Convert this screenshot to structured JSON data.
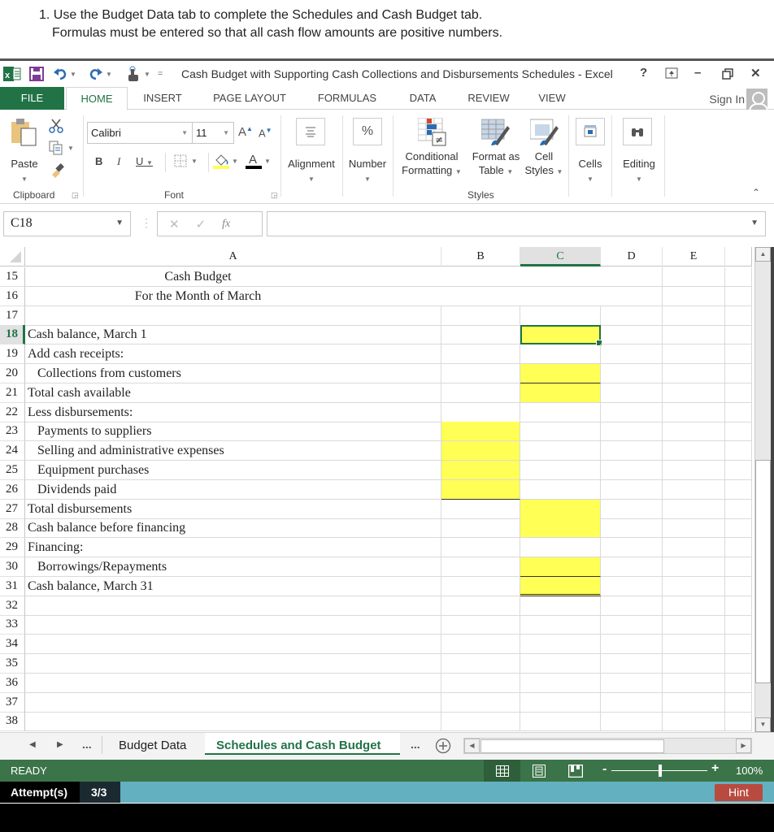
{
  "instructions": {
    "line1": "1. Use the Budget Data tab to complete the Schedules and Cash Budget tab.",
    "line2": "Formulas must be entered so that all cash flow amounts are positive numbers."
  },
  "window": {
    "title": "Cash Budget with Supporting Cash Collections and Disbursements Schedules - Excel",
    "help": "?",
    "minimize": "–",
    "restore": "🗗",
    "close": "✕"
  },
  "ribbon_tabs": [
    "FILE",
    "HOME",
    "INSERT",
    "PAGE LAYOUT",
    "FORMULAS",
    "DATA",
    "REVIEW",
    "VIEW"
  ],
  "sign_in": "Sign In",
  "ribbon": {
    "clipboard": {
      "paste": "Paste",
      "group": "Clipboard"
    },
    "font": {
      "name": "Calibri",
      "size": "11",
      "bold": "B",
      "italic": "I",
      "underline": "U",
      "group": "Font"
    },
    "alignment": "Alignment",
    "number": "Number",
    "number_icon": "%",
    "styles": {
      "conditional_1": "Conditional",
      "conditional_2": "Formatting",
      "format_table_1": "Format as",
      "format_table_2": "Table",
      "cell_styles_1": "Cell",
      "cell_styles_2": "Styles",
      "group": "Styles"
    },
    "cells": "Cells",
    "editing": "Editing"
  },
  "formula_bar": {
    "name_box": "C18",
    "formula": "",
    "fx": "fx"
  },
  "columns": [
    "A",
    "B",
    "C",
    "D",
    "E"
  ],
  "selected_column": "C",
  "rows": [
    {
      "n": "15",
      "a": "Cash Budget",
      "center": true
    },
    {
      "n": "16",
      "a": "For the Month of March",
      "center": true
    },
    {
      "n": "17",
      "a": ""
    },
    {
      "n": "18",
      "a": "Cash balance, March 1"
    },
    {
      "n": "19",
      "a": "Add cash receipts:"
    },
    {
      "n": "20",
      "a": "Collections from customers",
      "indent": true
    },
    {
      "n": "21",
      "a": "Total cash available"
    },
    {
      "n": "22",
      "a": "Less disbursements:"
    },
    {
      "n": "23",
      "a": "Payments to suppliers",
      "indent": true
    },
    {
      "n": "24",
      "a": "Selling and administrative expenses",
      "indent": true
    },
    {
      "n": "25",
      "a": "Equipment purchases",
      "indent": true
    },
    {
      "n": "26",
      "a": "Dividends paid",
      "indent": true
    },
    {
      "n": "27",
      "a": "Total disbursements"
    },
    {
      "n": "28",
      "a": "Cash balance before financing"
    },
    {
      "n": "29",
      "a": "Financing:"
    },
    {
      "n": "30",
      "a": "Borrowings/Repayments",
      "indent": true
    },
    {
      "n": "31",
      "a": "Cash balance, March 31"
    },
    {
      "n": "32",
      "a": ""
    },
    {
      "n": "33",
      "a": ""
    },
    {
      "n": "34",
      "a": ""
    },
    {
      "n": "35",
      "a": ""
    },
    {
      "n": "36",
      "a": ""
    },
    {
      "n": "37",
      "a": ""
    },
    {
      "n": "38",
      "a": ""
    }
  ],
  "active_cell": "C18",
  "input_cells": {
    "B": [
      "23",
      "24",
      "25",
      "26"
    ],
    "C": [
      "18",
      "20",
      "21",
      "27",
      "28",
      "30",
      "31"
    ]
  },
  "sheet_tabs": {
    "ellipsis": "...",
    "tab1": "Budget Data",
    "tab2": "Schedules and Cash Budget",
    "active": "Schedules and Cash Budget"
  },
  "status": {
    "ready": "READY",
    "zoom": "100%",
    "zoom_minus": "-",
    "zoom_plus": "+"
  },
  "attempts": {
    "label": "Attempt(s)",
    "value": "3/3",
    "hint": "Hint"
  },
  "colors": {
    "excel_green": "#217346",
    "status_green": "#3c7449",
    "input_yellow": "#ffff55",
    "attempts_bar": "#63b0c0",
    "hint_red": "#b94a3f"
  }
}
